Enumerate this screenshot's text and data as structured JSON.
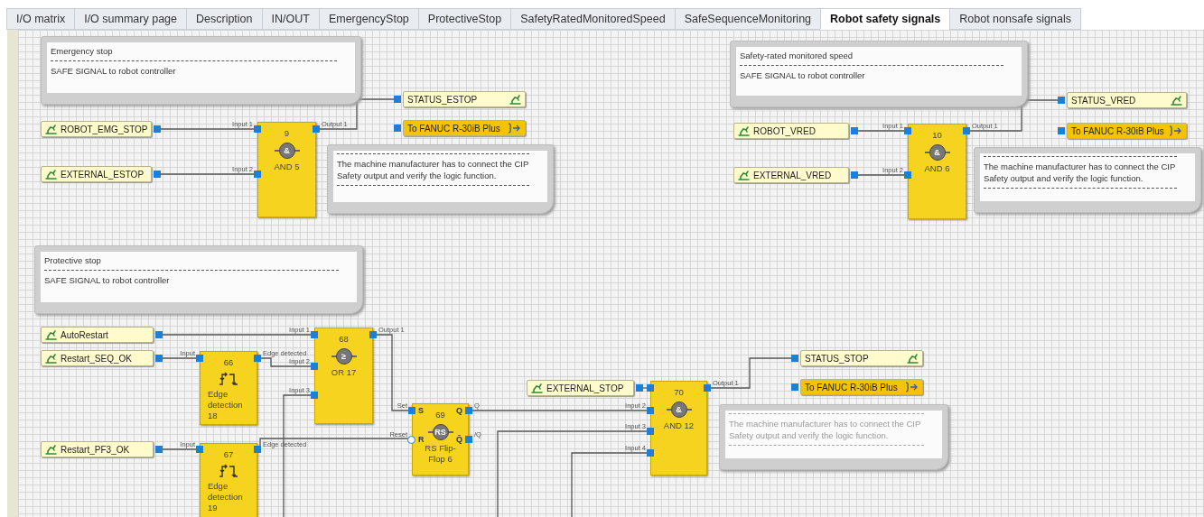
{
  "tabs": [
    {
      "label": "I/O matrix",
      "selected": false
    },
    {
      "label": "I/O summary page",
      "selected": false
    },
    {
      "label": "Description",
      "selected": false
    },
    {
      "label": "IN/OUT",
      "selected": false
    },
    {
      "label": "EmergencyStop",
      "selected": false
    },
    {
      "label": "ProtectiveStop",
      "selected": false
    },
    {
      "label": "SafetyRatedMonitoredSpeed",
      "selected": false
    },
    {
      "label": "SafeSequenceMonitoring",
      "selected": false
    },
    {
      "label": "Robot safety signals",
      "selected": true
    },
    {
      "label": "Robot nonsafe signals",
      "selected": false
    }
  ],
  "comments": [
    {
      "dimmed": false,
      "lines": [
        {
          "kind": "text",
          "text": "Emergency stop"
        },
        {
          "kind": "rule"
        },
        {
          "kind": "text",
          "text": "SAFE SIGNAL to robot controller"
        }
      ]
    },
    {
      "dimmed": false,
      "lines": [
        {
          "kind": "rule"
        },
        {
          "kind": "text",
          "text": "The machine manufacturer has to connect the CIP Safety output and verify the logic function."
        },
        {
          "kind": "rule"
        }
      ]
    },
    {
      "dimmed": false,
      "lines": [
        {
          "kind": "text",
          "text": "Safety-rated monitored speed"
        },
        {
          "kind": "rule"
        },
        {
          "kind": "text",
          "text": "SAFE SIGNAL to robot controller"
        }
      ]
    },
    {
      "dimmed": false,
      "lines": [
        {
          "kind": "rule"
        },
        {
          "kind": "text",
          "text": "The machine manufacturer has to connect the CIP Safety output and verify the logic function."
        },
        {
          "kind": "rule"
        }
      ]
    },
    {
      "dimmed": false,
      "lines": [
        {
          "kind": "text",
          "text": "Protective stop"
        },
        {
          "kind": "rule"
        },
        {
          "kind": "text",
          "text": "SAFE SIGNAL to robot controller"
        }
      ]
    },
    {
      "dimmed": true,
      "lines": [
        {
          "kind": "rule"
        },
        {
          "kind": "text",
          "text": "The machine manufacturer has to connect the CIP Safety output and verify the logic function."
        },
        {
          "kind": "rule"
        }
      ]
    }
  ],
  "signals": [
    {
      "kind": "input",
      "label": "ROBOT_EMG_STOP"
    },
    {
      "kind": "input",
      "label": "EXTERNAL_ESTOP"
    },
    {
      "kind": "output",
      "label": "STATUS_ESTOP"
    },
    {
      "kind": "device",
      "label": "To FANUC R-30iB Plus"
    },
    {
      "kind": "input",
      "label": "ROBOT_VRED"
    },
    {
      "kind": "input",
      "label": "EXTERNAL_VRED"
    },
    {
      "kind": "output",
      "label": "STATUS_VRED"
    },
    {
      "kind": "device",
      "label": "To FANUC R-30iB Plus"
    },
    {
      "kind": "input",
      "label": "AutoRestart"
    },
    {
      "kind": "input",
      "label": "Restart_SEQ_OK"
    },
    {
      "kind": "input",
      "label": "Restart_PF3_OK"
    },
    {
      "kind": "input",
      "label": "EXTERNAL_STOP"
    },
    {
      "kind": "output",
      "label": "STATUS_STOP"
    },
    {
      "kind": "device",
      "label": "To FANUC R-30iB Plus"
    }
  ],
  "blocks": [
    {
      "kind": "logic",
      "number": "9",
      "symbol": "&",
      "label": "AND 5",
      "inputs": [
        {
          "label": "Input 1",
          "negated": false
        },
        {
          "label": "Input 2",
          "negated": false
        }
      ],
      "outputs": [
        "Output 1"
      ]
    },
    {
      "kind": "logic",
      "number": "10",
      "symbol": "&",
      "label": "AND 6",
      "inputs": [
        {
          "label": "Input 1",
          "negated": false
        },
        {
          "label": "Input 2",
          "negated": false
        }
      ],
      "outputs": [
        "Output 1"
      ]
    },
    {
      "kind": "logic",
      "number": "68",
      "symbol": "≥",
      "label": "OR 17",
      "inputs": [
        {
          "label": "Input 1",
          "negated": false
        },
        {
          "label": "Input 2",
          "negated": false
        },
        {
          "label": "Input 3",
          "negated": false
        }
      ],
      "outputs": [
        "Output 1"
      ]
    },
    {
      "kind": "edge",
      "number": "66",
      "label": "Edge detection 18",
      "inputs": [
        {
          "label": "Input",
          "negated": false
        }
      ],
      "outputs": [
        "Edge detected"
      ]
    },
    {
      "kind": "edge",
      "number": "67",
      "label": "Edge detection 19",
      "inputs": [
        {
          "label": "Input",
          "negated": false
        }
      ],
      "outputs": [
        "Edge detected"
      ]
    },
    {
      "kind": "logic",
      "number": "69",
      "symbol": "RS",
      "label": "RS Flip-Flop 6",
      "inputs": [
        {
          "label": "Set",
          "negated": false
        },
        {
          "label": "Reset",
          "negated": true
        }
      ],
      "outputs": [
        "Q",
        "/Q"
      ],
      "inner_inputs": [
        "S",
        "R"
      ],
      "inner_outputs": [
        "Q",
        "Q̄"
      ]
    },
    {
      "kind": "logic",
      "number": "70",
      "symbol": "&",
      "label": "AND 12",
      "inputs": [
        {
          "negated": false
        },
        {
          "label": "Input 2",
          "negated": false
        },
        {
          "label": "Input 3",
          "negated": false
        },
        {
          "label": "Input 4",
          "negated": false
        }
      ],
      "outputs": [
        "Output 1"
      ]
    }
  ]
}
